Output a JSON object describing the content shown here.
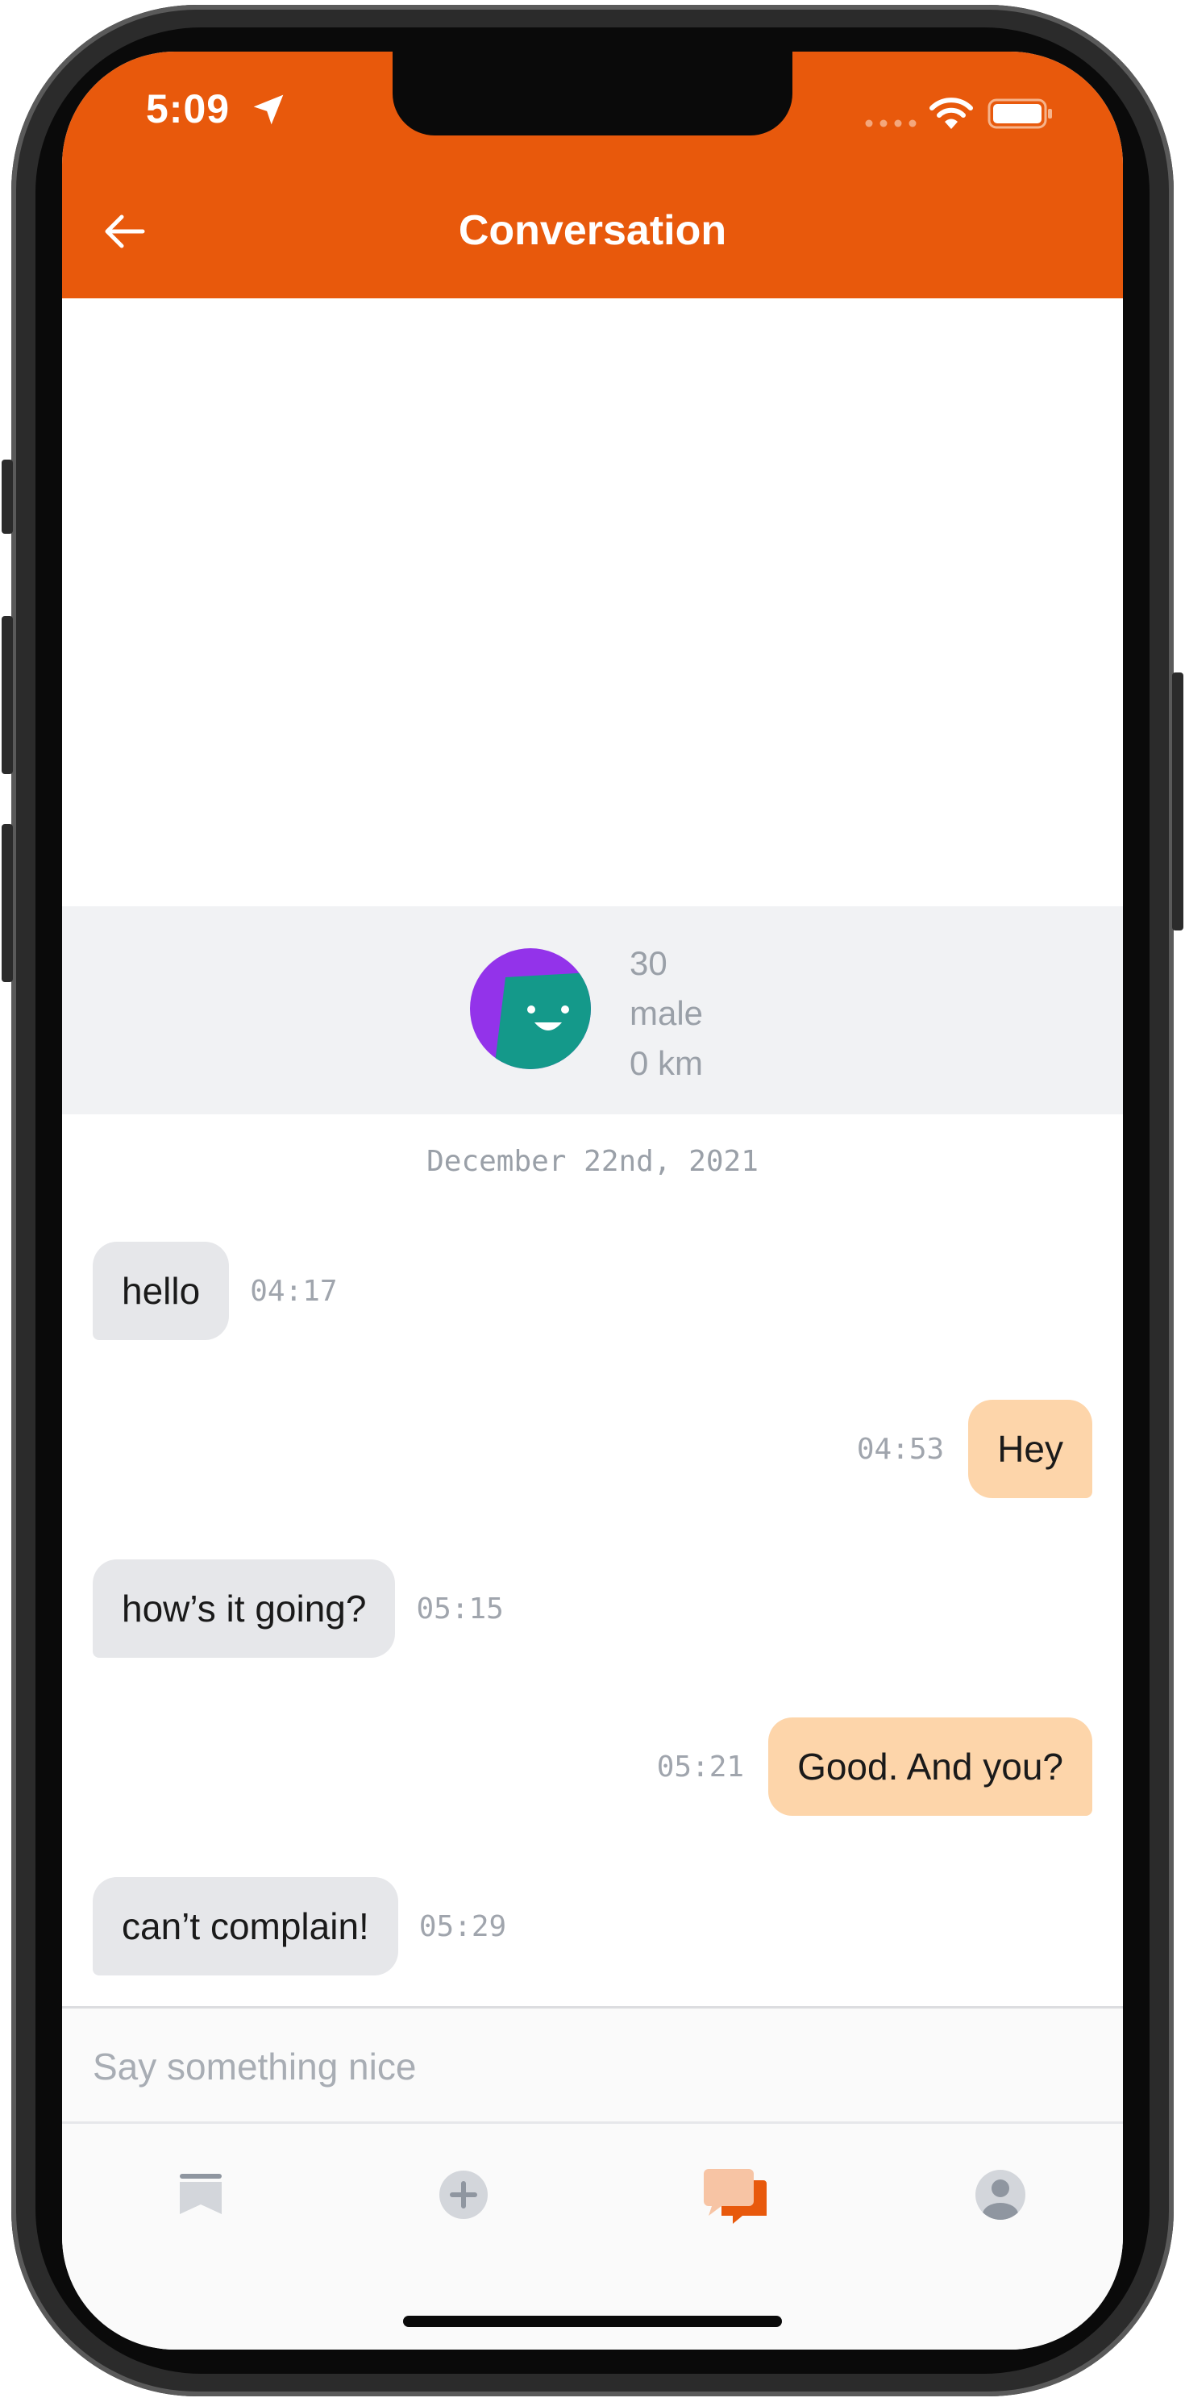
{
  "status_bar": {
    "time": "5:09"
  },
  "header": {
    "title": "Conversation"
  },
  "profile": {
    "age": "30",
    "gender": "male",
    "distance": "0 km"
  },
  "date_separator": "December 22nd, 2021",
  "messages": [
    {
      "side": "in",
      "text": "hello",
      "time": "04:17"
    },
    {
      "side": "out",
      "text": "Hey",
      "time": "04:53"
    },
    {
      "side": "in",
      "text": "how’s it going?",
      "time": "05:15"
    },
    {
      "side": "out",
      "text": "Good. And you?",
      "time": "05:21"
    },
    {
      "side": "in",
      "text": "can’t complain!",
      "time": "05:29"
    }
  ],
  "composer": {
    "placeholder": "Say something nice"
  },
  "tabs": [
    {
      "icon": "bookmark-icon",
      "active": false
    },
    {
      "icon": "plus-circle-icon",
      "active": false
    },
    {
      "icon": "chat-bubbles-icon",
      "active": true
    },
    {
      "icon": "user-icon",
      "active": false
    }
  ],
  "colors": {
    "accent": "#e8590c",
    "incoming_bubble": "#e6e7ea",
    "outgoing_bubble": "#fdd5aa",
    "muted_text": "#9aa0a8",
    "inactive_icon": "#9ca3af"
  }
}
